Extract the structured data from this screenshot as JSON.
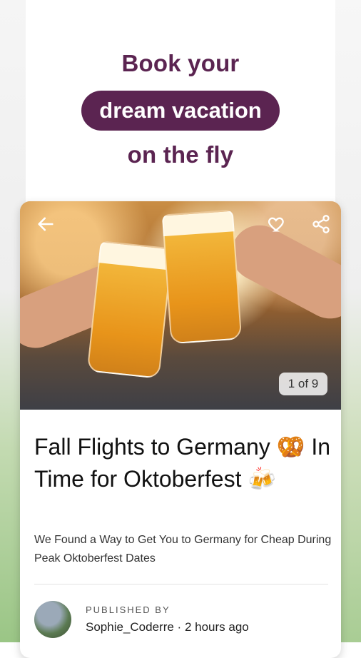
{
  "promo": {
    "line1": "Book your",
    "line2": "dream vacation",
    "line3": "on the fly",
    "accent_color": "#5b2451"
  },
  "card": {
    "image_counter": "1 of 9",
    "title": "Fall Flights to Germany 🥨 In Time for Oktoberfest 🍻",
    "subtitle": "We Found a Way to Get You to Germany for Cheap During Peak Oktoberfest Dates",
    "published_label": "PUBLISHED BY",
    "author": "Sophie_Coderre",
    "separator": "·",
    "time_ago": "2 hours ago",
    "icons": [
      "back-arrow-icon",
      "heart-icon",
      "share-icon"
    ]
  }
}
